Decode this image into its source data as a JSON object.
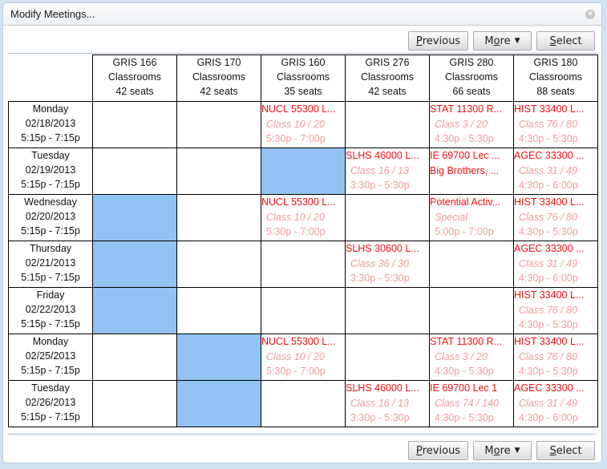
{
  "dialog": {
    "title": "Modify Meetings...",
    "close_icon": "close-icon"
  },
  "buttons": {
    "previous_label": "Previous",
    "previous_accel": "P",
    "more_label": "More",
    "more_accel": "o",
    "select_label": "Select",
    "select_accel": "S",
    "caret_icon": "▼"
  },
  "colors": {
    "selected_cell": "#93c3f2",
    "event_title": "#ee1111",
    "event_detail": "#f19a9a"
  },
  "rooms": [
    {
      "name": "GRIS 166",
      "type": "Classrooms",
      "seats": "42 seats"
    },
    {
      "name": "GRIS 170",
      "type": "Classrooms",
      "seats": "42 seats"
    },
    {
      "name": "GRIS 160",
      "type": "Classrooms",
      "seats": "35 seats"
    },
    {
      "name": "GRIS 276",
      "type": "Classrooms",
      "seats": "42 seats"
    },
    {
      "name": "GRIS 280",
      "type": "Classrooms",
      "seats": "66 seats"
    },
    {
      "name": "GRIS 180",
      "type": "Classrooms",
      "seats": "88 seats"
    }
  ],
  "rows": [
    {
      "day": "Monday",
      "date": "02/18/2013",
      "time": "5:15p - 7:15p",
      "cells": [
        {
          "selected": false
        },
        {
          "selected": false
        },
        {
          "selected": false,
          "title": "NUCL 55300 L...",
          "sub": "Class 10 / 20",
          "time": "5:30p - 7:00p"
        },
        {
          "selected": false
        },
        {
          "selected": false,
          "title": "STAT 11300 R...",
          "sub": "Class 3 / 20",
          "time": "4:30p - 5:30p"
        },
        {
          "selected": false,
          "title": "HIST 33400 L...",
          "sub": "Class 76 / 80",
          "time": "4:30p - 5:30p"
        }
      ]
    },
    {
      "day": "Tuesday",
      "date": "02/19/2013",
      "time": "5:15p - 7:15p",
      "cells": [
        {
          "selected": false
        },
        {
          "selected": false
        },
        {
          "selected": true
        },
        {
          "selected": false,
          "title": "SLHS 46000 L...",
          "sub": "Class 16 / 13",
          "time": "3:30p - 5:30p"
        },
        {
          "selected": false,
          "title": "IE 69700 Lec ...",
          "desc": "Big Brothers, ..."
        },
        {
          "selected": false,
          "title": "AGEC 33300 ...",
          "sub": "Class 31 / 49",
          "time": "4:30p - 6:00p"
        }
      ]
    },
    {
      "day": "Wednesday",
      "date": "02/20/2013",
      "time": "5:15p - 7:15p",
      "cells": [
        {
          "selected": true
        },
        {
          "selected": false
        },
        {
          "selected": false,
          "title": "NUCL 55300 L...",
          "sub": "Class 10 / 20",
          "time": "5:30p - 7:00p"
        },
        {
          "selected": false
        },
        {
          "selected": false,
          "title": "Potential Activ...",
          "sub": "Special",
          "time": "5:00p - 7:00p"
        },
        {
          "selected": false,
          "title": "HIST 33400 L...",
          "sub": "Class 76 / 80",
          "time": "4:30p - 5:30p"
        }
      ]
    },
    {
      "day": "Thursday",
      "date": "02/21/2013",
      "time": "5:15p - 7:15p",
      "cells": [
        {
          "selected": true
        },
        {
          "selected": false
        },
        {
          "selected": false
        },
        {
          "selected": false,
          "title": "SLHS 30600 L...",
          "sub": "Class 36 / 30",
          "time": "3:30p - 5:30p"
        },
        {
          "selected": false
        },
        {
          "selected": false,
          "title": "AGEC 33300 ...",
          "sub": "Class 31 / 49",
          "time": "4:30p - 6:00p"
        }
      ]
    },
    {
      "day": "Friday",
      "date": "02/22/2013",
      "time": "5:15p - 7:15p",
      "cells": [
        {
          "selected": true
        },
        {
          "selected": false
        },
        {
          "selected": false
        },
        {
          "selected": false
        },
        {
          "selected": false
        },
        {
          "selected": false,
          "title": "HIST 33400 L...",
          "sub": "Class 76 / 80",
          "time": "4:30p - 5:30p"
        }
      ]
    },
    {
      "day": "Monday",
      "date": "02/25/2013",
      "time": "5:15p - 7:15p",
      "cells": [
        {
          "selected": false
        },
        {
          "selected": true
        },
        {
          "selected": false,
          "title": "NUCL 55300 L...",
          "sub": "Class 10 / 20",
          "time": "5:30p - 7:00p"
        },
        {
          "selected": false
        },
        {
          "selected": false,
          "title": "STAT 11300 R...",
          "sub": "Class 3 / 20",
          "time": "4:30p - 5:30p"
        },
        {
          "selected": false,
          "title": "HIST 33400 L...",
          "sub": "Class 76 / 80",
          "time": "4:30p - 5:30p"
        }
      ]
    },
    {
      "day": "Tuesday",
      "date": "02/26/2013",
      "time": "5:15p - 7:15p",
      "cells": [
        {
          "selected": false
        },
        {
          "selected": true
        },
        {
          "selected": false
        },
        {
          "selected": false,
          "title": "SLHS 46000 L...",
          "sub": "Class 16 / 13",
          "time": "3:30p - 5:30p"
        },
        {
          "selected": false,
          "title": "IE 69700 Lec 1",
          "sub": "Class 74 / 140",
          "time": "4:30p - 5:30p"
        },
        {
          "selected": false,
          "title": "AGEC 33300 ...",
          "sub": "Class 31 / 49",
          "time": "4:30p - 6:00p"
        }
      ]
    }
  ]
}
